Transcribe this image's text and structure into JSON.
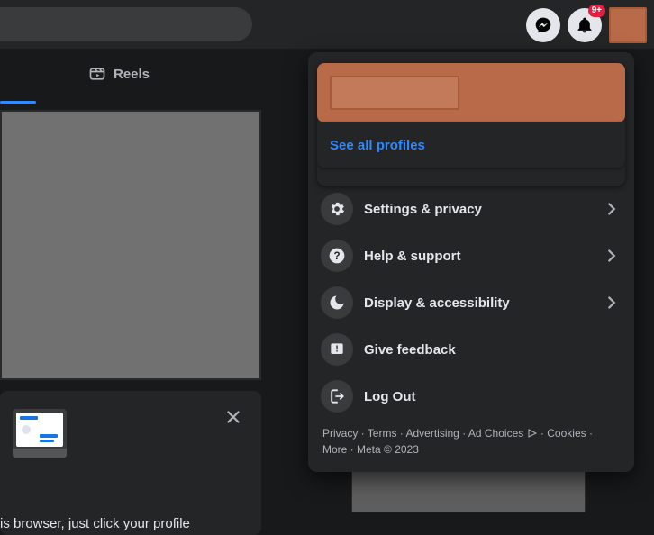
{
  "topbar": {
    "notification_badge": "9+"
  },
  "tabs": {
    "reels_label": "Reels"
  },
  "promo": {
    "text_fragment": "is browser, just click your profile"
  },
  "dropdown": {
    "see_all": "See all profiles",
    "items": [
      {
        "label": "Settings & privacy"
      },
      {
        "label": "Help & support"
      },
      {
        "label": "Display & accessibility"
      },
      {
        "label": "Give feedback"
      },
      {
        "label": "Log Out"
      }
    ],
    "legal": {
      "privacy": "Privacy",
      "terms": "Terms",
      "advertising": "Advertising",
      "ad_choices": "Ad Choices",
      "cookies": "Cookies",
      "more": "More",
      "meta": "Meta © 2023"
    }
  }
}
